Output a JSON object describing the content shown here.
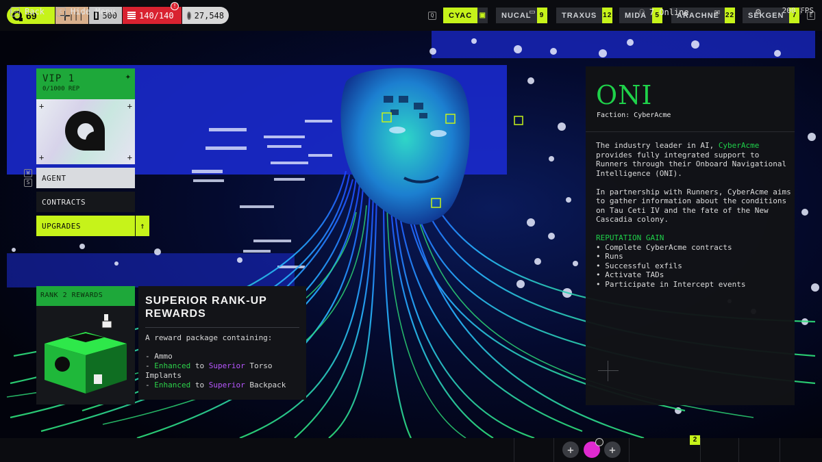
{
  "topbar": {
    "level": "69",
    "seg_b_value": "500",
    "seg_c_value": "140/140",
    "seg_d_value": "27,548",
    "key_left": "Q",
    "fps": "200 FPS",
    "factions": [
      {
        "name": "CYAC",
        "count": "",
        "active": true
      },
      {
        "name": "NUCAL",
        "count": "9"
      },
      {
        "name": "TRAXUS",
        "count": "12"
      },
      {
        "name": "MIDA",
        "count": "5"
      },
      {
        "name": "ARACHNE",
        "count": "22"
      },
      {
        "name": "SEKGEN",
        "count": "7"
      }
    ],
    "key_right": "E"
  },
  "left_menu": {
    "vip_title": "VIP 1",
    "vip_rep": "0/1000 REP",
    "key_w": "W",
    "key_s": "S",
    "items": [
      "AGENT",
      "CONTRACTS",
      "UPGRADES"
    ]
  },
  "rank": {
    "header": "RANK 2 REWARDS",
    "title": "SUPERIOR RANK-UP REWARDS",
    "intro": "A reward package containing:",
    "items": [
      {
        "prefix": "- ",
        "text": "Ammo"
      },
      {
        "prefix": "- ",
        "tier_from": "Enhanced",
        "to": " to ",
        "tier_to": "Superior",
        "text": " Torso Implants"
      },
      {
        "prefix": "- ",
        "tier_from": "Enhanced",
        "to": " to ",
        "tier_to": "Superior",
        "text": " Backpack"
      }
    ]
  },
  "info": {
    "title": "ONI",
    "faction": "Faction: CyberAcme",
    "p1_a": "The industry leader in AI, ",
    "p1_link": "CyberAcme",
    "p1_b": " provides fully integrated support to Runners through their Onboard Navigational Intelligence (ONI).",
    "p2": "In partnership with Runners, CyberAcme aims to gather information about the conditions on Tau Ceti IV and the fate of the New Cascadia colony.",
    "rep_header": "REPUTATION GAIN",
    "rep_items": [
      "• Complete CyberAcme contracts",
      "• Runs",
      "• Successful exfils",
      "• Activate TADs",
      "• Participate in Intercept events"
    ]
  },
  "bottombar": {
    "back_key": "ESC",
    "back_label": "Back",
    "hide_key": "C",
    "hide_label": "Hide Menu",
    "online": "7 Online",
    "mail_badge": "2"
  },
  "colors": {
    "accent_lime": "#c6f31a",
    "faction_green": "#1fd14a",
    "health_red": "#d92230",
    "enhanced_green": "#2cd24a",
    "superior_purple": "#b857ff"
  }
}
